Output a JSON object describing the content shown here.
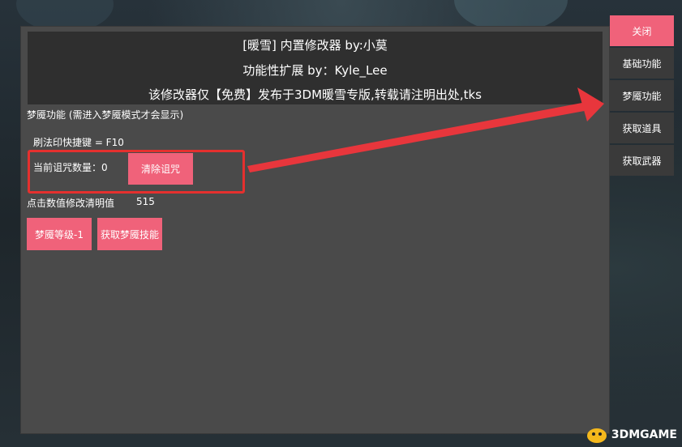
{
  "header": {
    "line1": "[暖雪] 内置修改器 by:小莫",
    "line2": "功能性扩展 by：Kyle_Lee",
    "line3": "该修改器仅【免费】发布于3DM暖雪专版,转载请注明出处,tks"
  },
  "section": {
    "title": "梦魇功能 (需进入梦魇模式才会显示)",
    "hotkey": "刷法印快捷键 = F10",
    "curse_label": "当前诅咒数量：",
    "curse_count": "0",
    "clear_curse_button": "清除诅咒",
    "clarity_label": "点击数值修改清明值",
    "clarity_value": "515",
    "nightmare_level_button": "梦魇等级-1",
    "nightmare_skill_button": "获取梦魇技能"
  },
  "sidebar": {
    "close": "关闭",
    "items": [
      "基础功能",
      "梦魇功能",
      "获取道具",
      "获取武器"
    ]
  },
  "watermark": {
    "text": "3DMGAME"
  },
  "colors": {
    "accent": "#f0627a",
    "annotation_red": "#e5302e",
    "panel": "#4a4a4a",
    "header": "#2f2f2f"
  }
}
